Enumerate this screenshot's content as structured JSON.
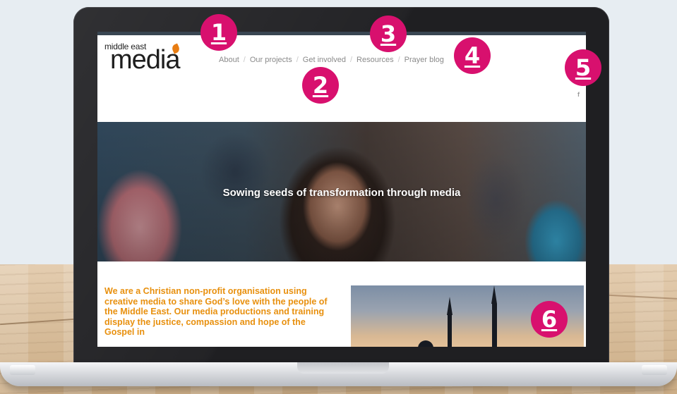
{
  "site": {
    "logo_small": "middle east",
    "logo_big": "media"
  },
  "nav": {
    "items": [
      {
        "label": "About"
      },
      {
        "label": "Our projects"
      },
      {
        "label": "Get involved"
      },
      {
        "label": "Resources"
      },
      {
        "label": "Prayer blog"
      }
    ],
    "separator": "/"
  },
  "social": {
    "facebook_icon": "f"
  },
  "hero": {
    "title": "Sowing seeds of transformation through media"
  },
  "intro": {
    "text": "We are a Christian non-profit organisation using creative media to share God’s love with the people of the Middle East. Our media productions and training display the justice, compassion and hope of the Gospel in"
  },
  "badges": [
    "1",
    "2",
    "3",
    "4",
    "5",
    "6"
  ],
  "colors": {
    "accent_orange": "#e8900e",
    "badge_pink": "#d8106e",
    "nav_text": "#8a8a8a",
    "top_strip": "#394652"
  }
}
